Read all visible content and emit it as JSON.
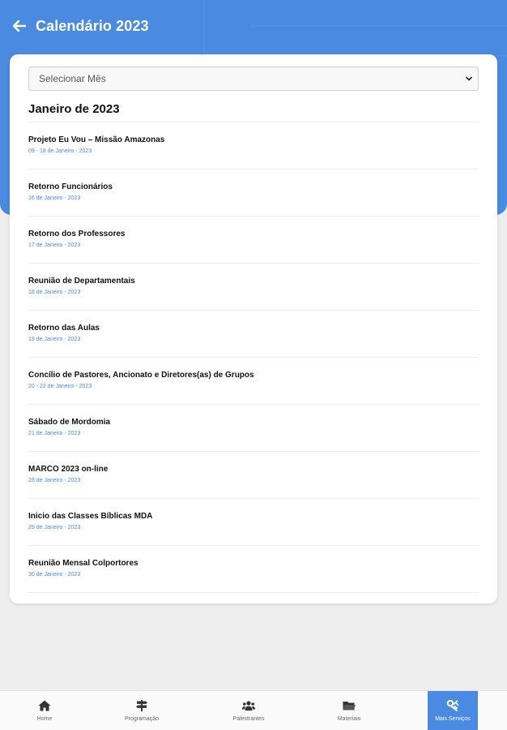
{
  "header": {
    "title": "Calendário 2023",
    "back_icon": "arrow-left-icon",
    "background_color": "#4a8ae0"
  },
  "filter": {
    "select_label": "Selecionar Mês",
    "dropdown_icon": "chevron-down-icon"
  },
  "month": {
    "heading": "Janeiro de 2023",
    "events": [
      {
        "title": "Projeto Eu Vou – Missão Amazonas",
        "date": "09 - 18 de Janeiro - 2023"
      },
      {
        "title": "Retorno Funcionários",
        "date": "16 de Janeiro - 2023"
      },
      {
        "title": "Retorno dos Professores",
        "date": "17 de Janeiro - 2023"
      },
      {
        "title": "Reunião de Departamentais",
        "date": "18 de Janeiro - 2023"
      },
      {
        "title": "Retorno das Aulas",
        "date": "19 de Janeiro - 2023"
      },
      {
        "title": "Concílio de Pastores, Ancionato e Diretores(as) de Grupos",
        "date": "20 - 22 de Janeiro - 2023"
      },
      {
        "title": "Sábado de Mordomia",
        "date": "21 de Janeiro - 2023"
      },
      {
        "title": "MARCO 2023 on-line",
        "date": "28 de Janeiro - 2023"
      },
      {
        "title": "Inicio das Classes Bíblicas MDA",
        "date": "29 de Janeiro - 2023"
      },
      {
        "title": "Reunião Mensal Colportores",
        "date": "30 de Janeiro - 2023"
      }
    ]
  },
  "bottom_nav": {
    "items": [
      {
        "label": "Home",
        "icon": "home-icon"
      },
      {
        "label": "Programação",
        "icon": "signpost-icon"
      },
      {
        "label": "Palestrantes",
        "icon": "users-icon"
      },
      {
        "label": "Materiais",
        "icon": "folder-icon"
      },
      {
        "label": "Mais Serviços",
        "icon": "services-icon",
        "active": true
      }
    ],
    "active_color": "#4a8ae0"
  }
}
